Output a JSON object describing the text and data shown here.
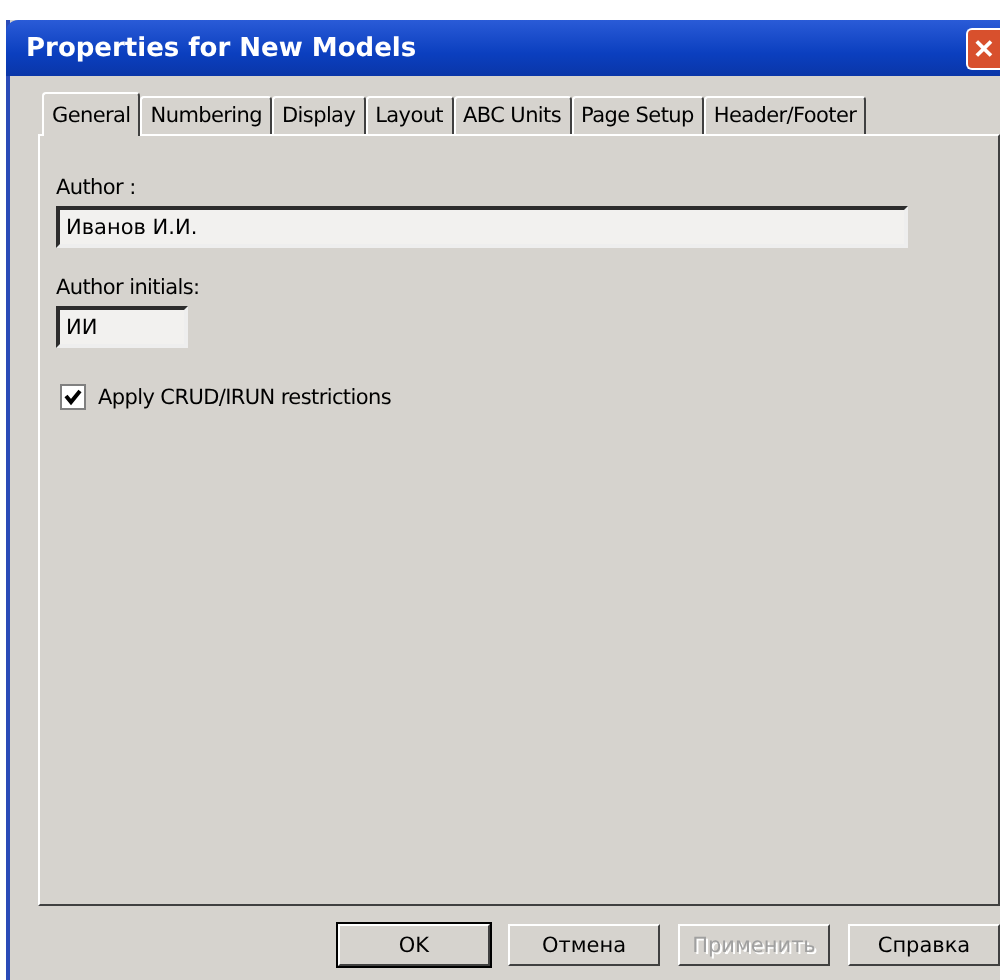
{
  "window": {
    "title": "Properties for New Models",
    "close": "✕"
  },
  "tabs": [
    {
      "label": "General",
      "selected": true
    },
    {
      "label": "Numbering",
      "selected": false
    },
    {
      "label": "Display",
      "selected": false
    },
    {
      "label": "Layout",
      "selected": false
    },
    {
      "label": "ABC Units",
      "selected": false
    },
    {
      "label": "Page Setup",
      "selected": false
    },
    {
      "label": "Header/Footer",
      "selected": false
    }
  ],
  "fields": [
    {
      "label": "Author :",
      "value": "Иванов И.И."
    },
    {
      "label": "Author initials:",
      "value": "ИИ"
    }
  ],
  "checkbox": {
    "label": "Apply CRUD/IRUN restrictions",
    "checked": true
  },
  "buttons": [
    {
      "label": "OK",
      "disabled": false,
      "default": true
    },
    {
      "label": "Отмена",
      "disabled": false,
      "default": false
    },
    {
      "label": "Применить",
      "disabled": true,
      "default": false
    },
    {
      "label": "Справка",
      "disabled": false,
      "default": false
    }
  ]
}
